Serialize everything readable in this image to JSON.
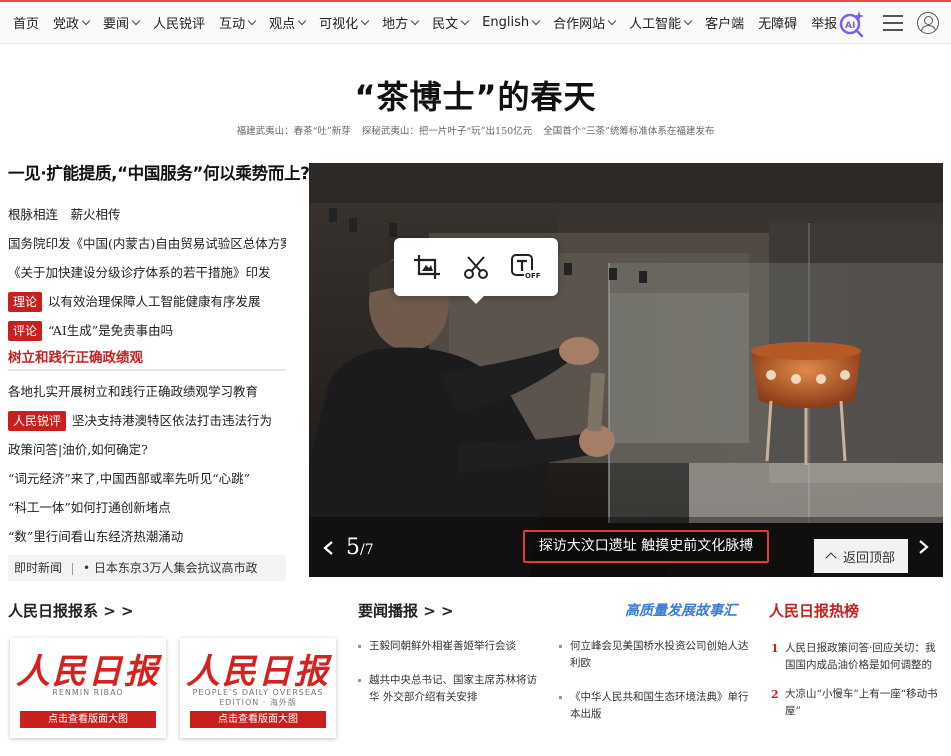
{
  "nav": {
    "items": [
      {
        "label": "首页",
        "dropdown": false
      },
      {
        "label": "党政",
        "dropdown": true
      },
      {
        "label": "要闻",
        "dropdown": true
      },
      {
        "label": "人民锐评",
        "dropdown": false
      },
      {
        "label": "互动",
        "dropdown": true
      },
      {
        "label": "观点",
        "dropdown": true
      },
      {
        "label": "可视化",
        "dropdown": true
      },
      {
        "label": "地方",
        "dropdown": true
      },
      {
        "label": "民文",
        "dropdown": true
      },
      {
        "label": "English",
        "dropdown": true
      },
      {
        "label": "合作网站",
        "dropdown": true
      },
      {
        "label": "人工智能",
        "dropdown": true
      },
      {
        "label": "客户端",
        "dropdown": false
      },
      {
        "label": "无障碍",
        "dropdown": false
      },
      {
        "label": "举报",
        "dropdown": false
      }
    ],
    "ai_icon": "ai-search-icon",
    "menu_icon": "hamburger-menu-icon",
    "user_icon": "user-account-icon"
  },
  "headline": {
    "title": "“茶博士”的春天",
    "subheads": [
      "福建武夷山：春茶“吐”新芽",
      "探秘武夷山：把一片叶子“玩”出150亿元",
      "全国首个“三茶”统筹标准体系在福建发布"
    ]
  },
  "left": {
    "title": "一见·扩能提质,“中国服务”何以乘势而上?",
    "lines1": [
      {
        "text": "根脉相连　薪火相传"
      },
      {
        "text": "国务院印发《中国(内蒙古)自由贸易试验区总体方案》"
      },
      {
        "text": "《关于加快建设分级诊疗体系的若干措施》印发"
      },
      {
        "tag": "理论",
        "text": "以有效治理保障人工智能健康有序发展"
      },
      {
        "tag": "评论",
        "text": "“AI生成”是免责事由吗"
      }
    ],
    "section": "树立和践行正确政绩观",
    "lines2": [
      {
        "text": "各地扎实开展树立和践行正确政绩观学习教育"
      },
      {
        "tag": "人民锐评",
        "text": "坚决支持港澳特区依法打击违法行为"
      },
      {
        "text": "政策问答|油价,如何确定?"
      },
      {
        "text": "“词元经济”来了,中国西部或率先听见“心跳”"
      },
      {
        "text": "“科工一体”如何打通创新堵点"
      },
      {
        "text": "“数”里行间看山东经济热潮涌动"
      }
    ],
    "ticker": {
      "label": "即时新闻",
      "text": "• 日本东京3万人集会抗议高市政"
    }
  },
  "photo": {
    "counter_current": "5",
    "counter_total": "/7",
    "caption": "探访大汶口遗址  触摸史前文化脉搏",
    "back_to_top": "返回顶部",
    "toolbar": [
      "crop-image-icon",
      "scissors-cut-icon",
      "text-off-icon"
    ]
  },
  "bottom": {
    "papers_title": "人民日报报系 > >",
    "papers": [
      {
        "mast": "人民日报",
        "sub": "RENMIN RIBAO",
        "button": "点击查看版面大图"
      },
      {
        "mast": "人民日报",
        "sub": "PEOPLE'S DAILY OVERSEAS EDITION · 海外版",
        "button": "点击查看版面大图"
      }
    ],
    "news_title": "要闻播报 > >",
    "story_title": "高质量发展故事汇",
    "news_col1": [
      "王毅同朝鲜外相崔善姬举行会谈",
      "越共中央总书记、国家主席苏林将访华 外交部介绍有关安排"
    ],
    "news_col2": [
      "何立峰会见美国桥水投资公司创始人达利欧",
      "《中华人民共和国生态环境法典》单行本出版"
    ],
    "hot_title": "人民日报热榜",
    "hot": [
      {
        "num": "1",
        "text": "人民日报政策问答·回应关切：我国国内成品油价格是如何调整的"
      },
      {
        "num": "2",
        "text": "大凉山“小慢车”上有一座“移动书屋”"
      }
    ]
  },
  "colors": {
    "brand_red": "#c8201f",
    "story_blue": "#3a7bd5",
    "caption_border": "#e03c35"
  }
}
